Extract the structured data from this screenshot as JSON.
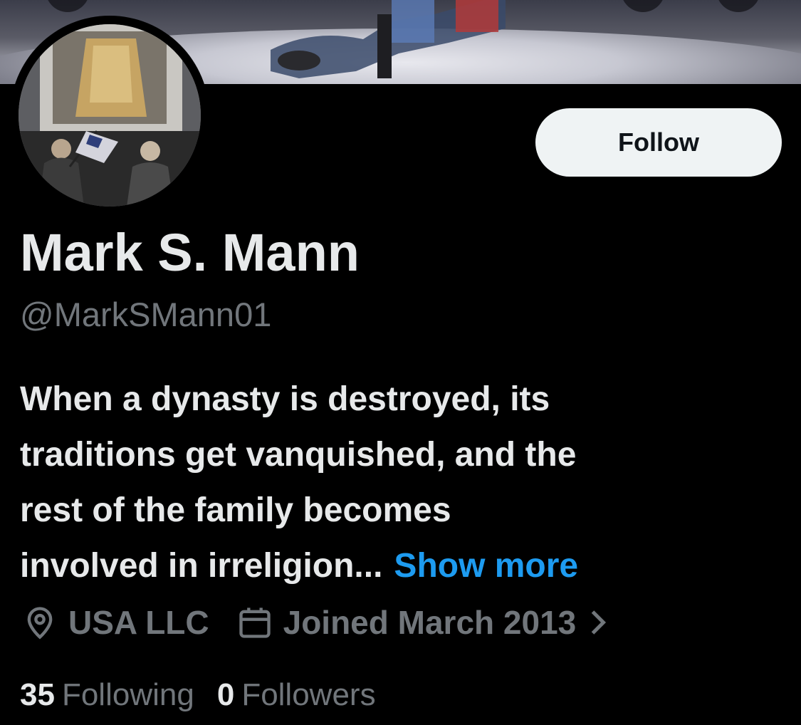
{
  "profile": {
    "follow_label": "Follow",
    "name": "Mark S. Mann",
    "handle": "@MarkSMann01",
    "bio_lines": [
      "When a dynasty is destroyed, its",
      "traditions get vanquished, and the",
      "rest of the family becomes",
      "involved in irreligion..."
    ],
    "show_more": "Show more",
    "location": "USA LLC",
    "joined": "Joined March 2013",
    "following_count": "35",
    "following_label": "Following",
    "followers_count": "0",
    "followers_label": "Followers"
  },
  "colors": {
    "background": "#000000",
    "text_primary": "#e7e9ea",
    "text_secondary": "#71767b",
    "link": "#1d9bf0",
    "follow_button_bg": "#eff3f4"
  },
  "icons": [
    "location-pin-icon",
    "calendar-icon",
    "chevron-right-icon"
  ]
}
